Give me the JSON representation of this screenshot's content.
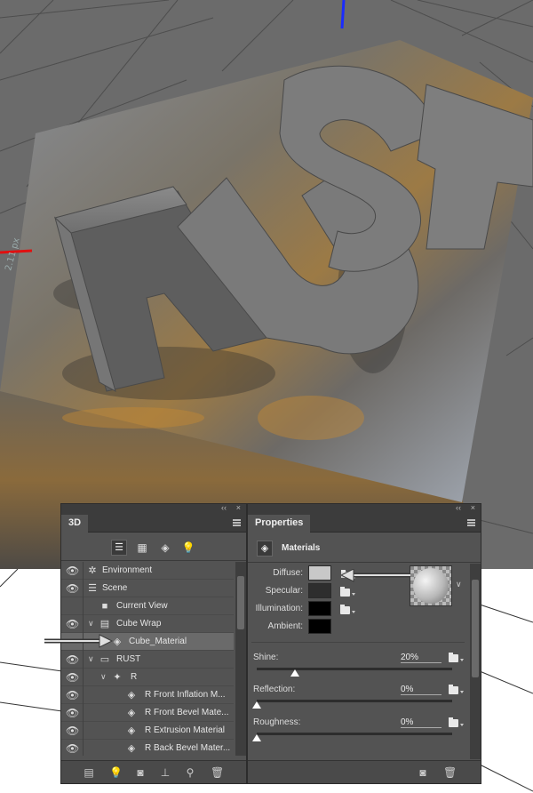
{
  "panel_3d": {
    "tab": "3D",
    "top_controls": {
      "collapse": "‹‹",
      "close": "×"
    },
    "filter_icons": [
      "scene-filter-icon",
      "mesh-filter-icon",
      "material-filter-icon",
      "light-filter-icon"
    ],
    "rows": [
      {
        "label": "Environment"
      },
      {
        "label": "Scene"
      },
      {
        "label": "Current View"
      },
      {
        "label": "Cube Wrap"
      },
      {
        "label": "Cube_Material"
      },
      {
        "label": "RUST"
      },
      {
        "label": "R"
      },
      {
        "label": "R Front Inflation M..."
      },
      {
        "label": "R Front Bevel Mate..."
      },
      {
        "label": "R Extrusion Material"
      },
      {
        "label": "R Back Bevel Mater..."
      }
    ]
  },
  "panel_props": {
    "tab": "Properties",
    "top_controls": {
      "collapse": "‹‹",
      "close": "×"
    },
    "section_title": "Materials",
    "diffuse_label": "Diffuse:",
    "specular_label": "Specular:",
    "illumination_label": "Illumination:",
    "ambient_label": "Ambient:",
    "shine_label": "Shine:",
    "shine_value": "20%",
    "shine_level": 0.2,
    "reflection_label": "Reflection:",
    "reflection_value": "0%",
    "reflection_level": 0,
    "roughness_label": "Roughness:",
    "roughness_value": "0%",
    "roughness_level": 0
  },
  "scene": {
    "text": "RUST",
    "ruler_label": "2.11 px"
  },
  "colors": {
    "panel_bg": "#535353",
    "diffuse": "#c8c8c8",
    "specular": "#2e2e2e",
    "illumination": "#000000",
    "ambient": "#000000",
    "axis_blue": "#1a2cff",
    "axis_red": "#e01010"
  }
}
